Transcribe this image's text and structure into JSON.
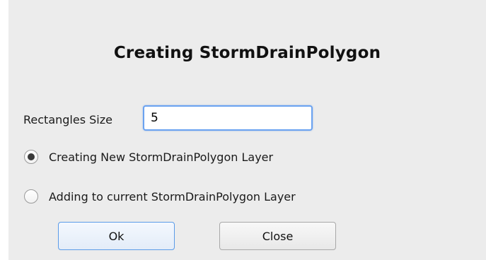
{
  "dialog": {
    "title": "Creating StormDrainPolygon",
    "size_label": "Rectangles Size",
    "size_value": "5",
    "options": [
      {
        "label": "Creating New StormDrainPolygon Layer",
        "selected": true
      },
      {
        "label": "Adding to current StormDrainPolygon Layer",
        "selected": false
      }
    ],
    "ok_label": "Ok",
    "close_label": "Close"
  }
}
